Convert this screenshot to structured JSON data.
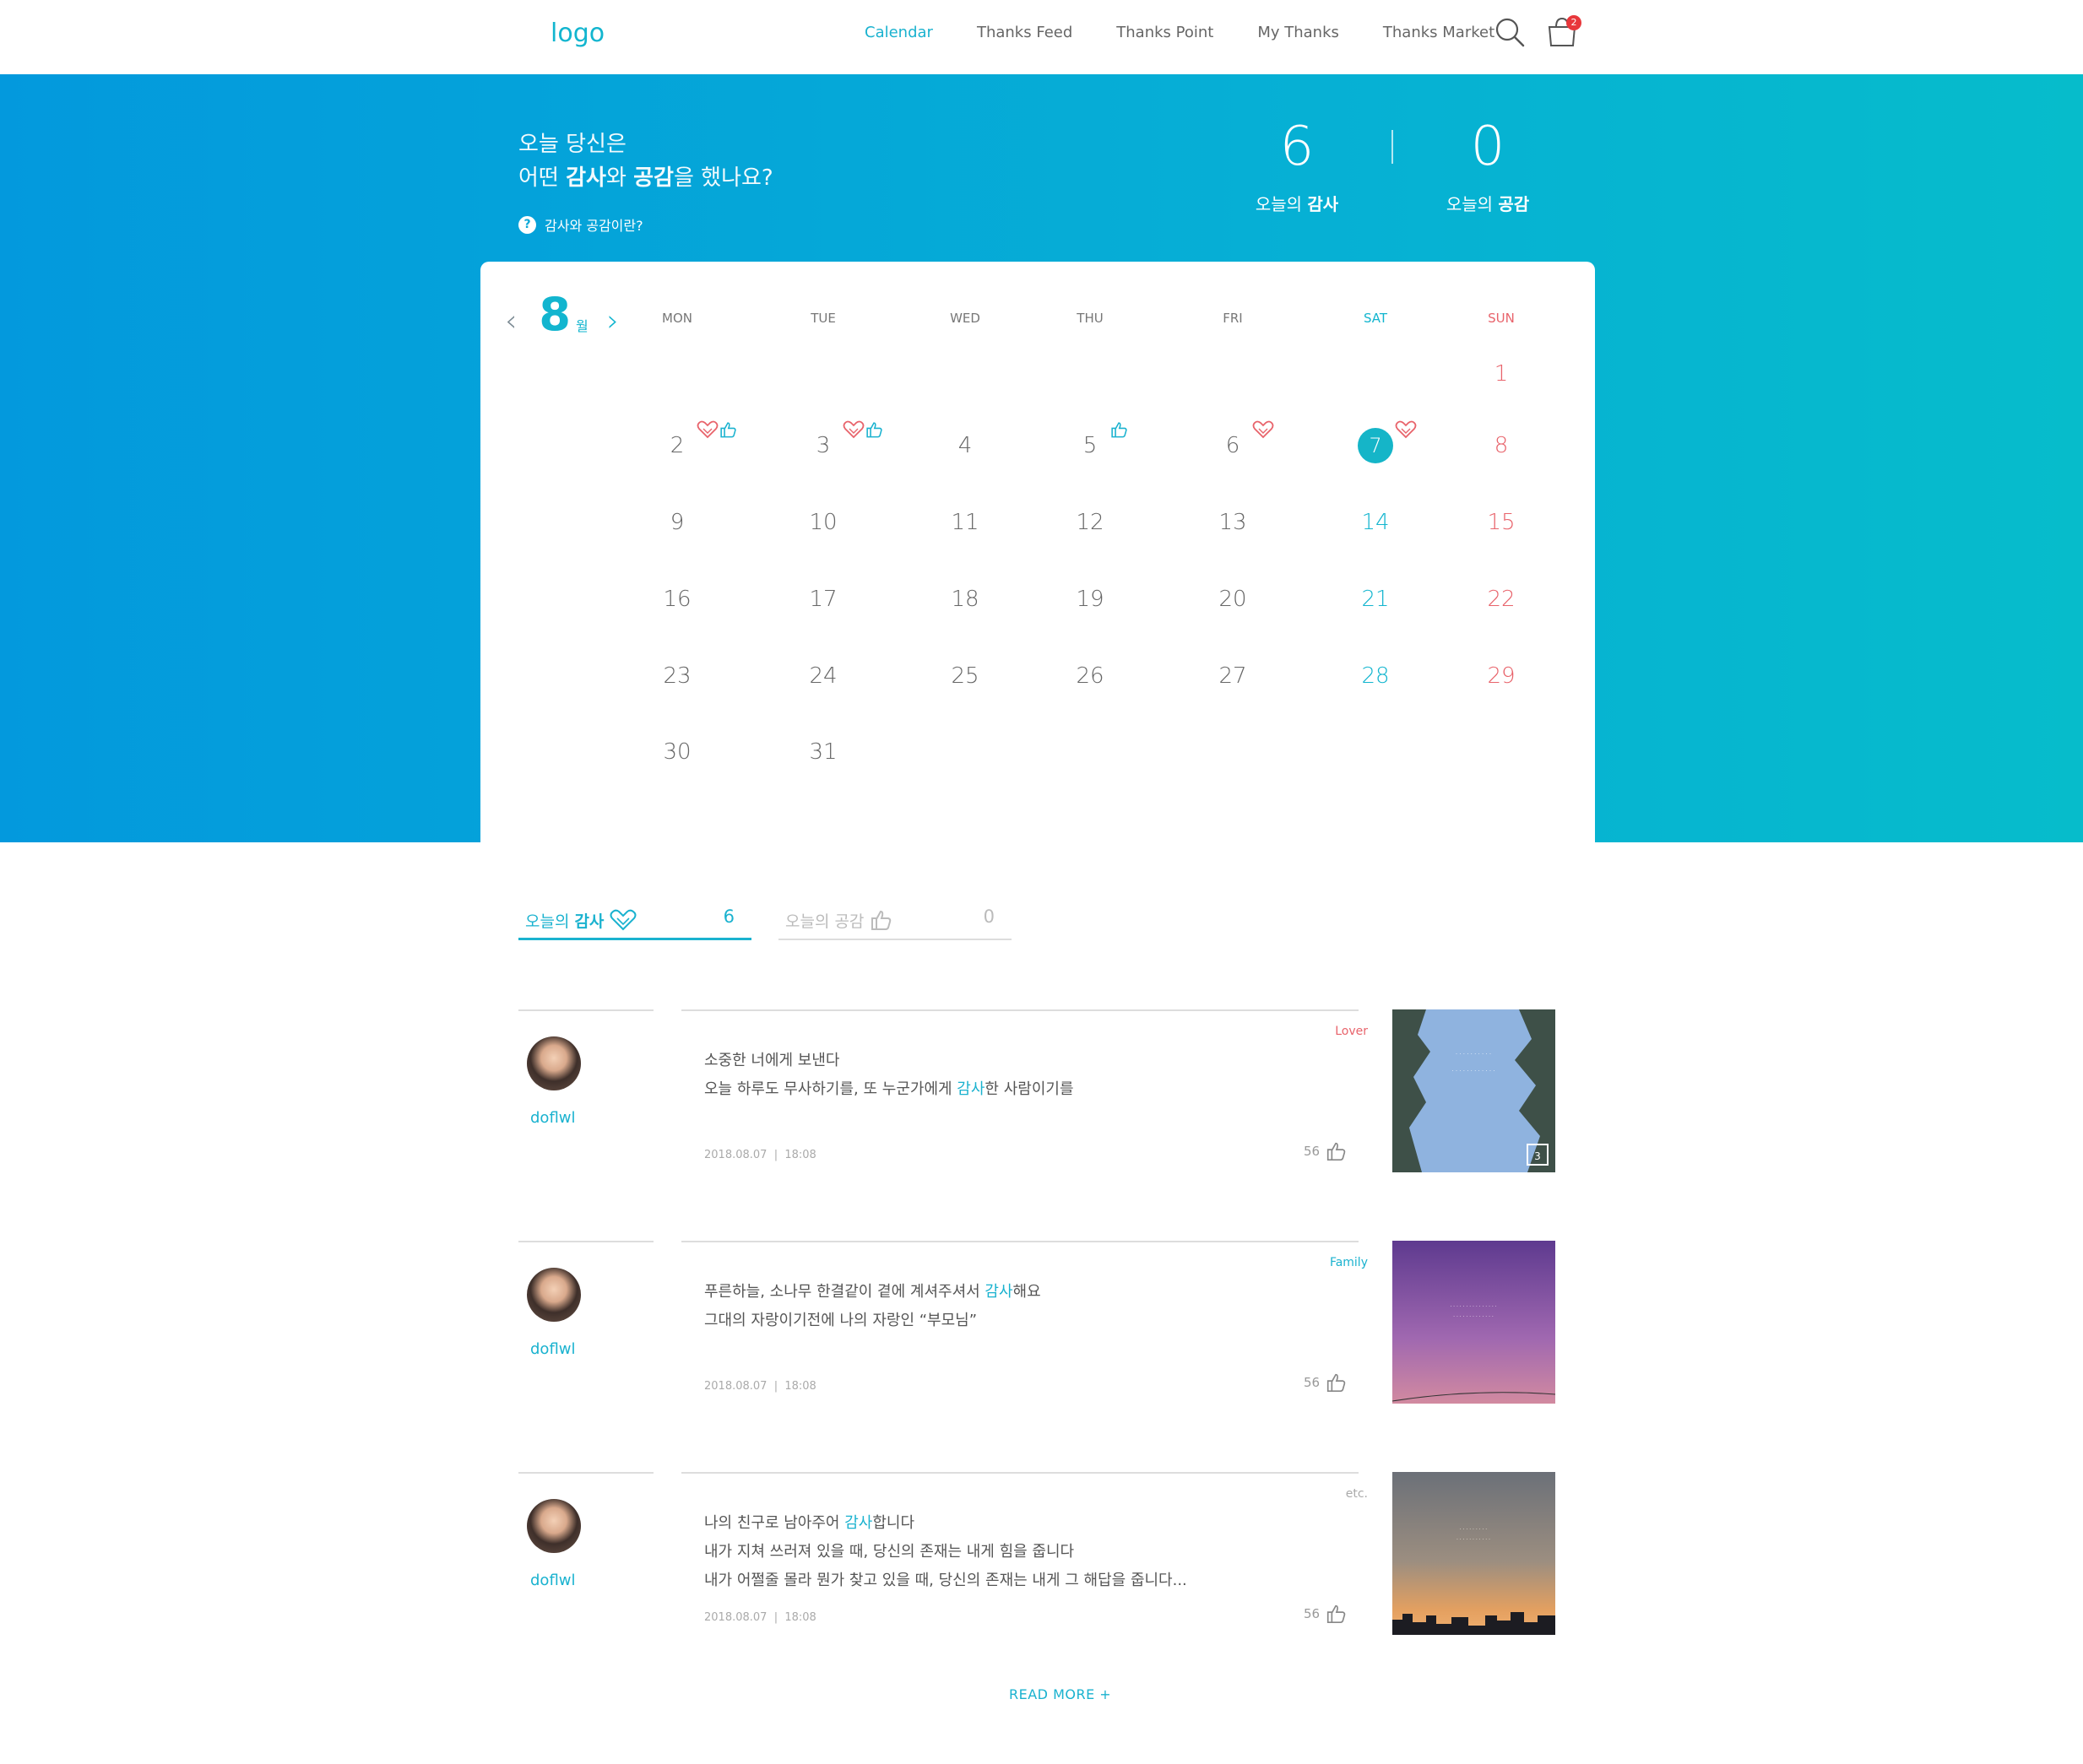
{
  "header": {
    "logo": "logo",
    "nav": [
      "Calendar",
      "Thanks Feed",
      "Thanks Point",
      "My Thanks",
      "Thanks Market"
    ],
    "active_nav": "Calendar",
    "cart_count": "2"
  },
  "hero": {
    "line1": "오늘 당신은",
    "line2_pre": "어떤 ",
    "line2_b1": "감사",
    "line2_mid": "와 ",
    "line2_b2": "공감",
    "line2_post": "을 했나요?",
    "help": "감사와 공감이란?",
    "thanks_count": "6",
    "thanks_label_pre": "오늘의 ",
    "thanks_label_b": "감사",
    "empathy_count": "0",
    "empathy_label_pre": "오늘의 ",
    "empathy_label_b": "공감"
  },
  "calendar": {
    "month": "8",
    "month_unit": "월",
    "weekdays": [
      "MON",
      "TUE",
      "WED",
      "THU",
      "FRI",
      "SAT",
      "SUN"
    ],
    "today": 7,
    "first_weekday_index": 6,
    "days_in_month": 31,
    "marks": {
      "2": [
        "heart",
        "like"
      ],
      "3": [
        "heart",
        "like"
      ],
      "5": [
        "like"
      ],
      "6": [
        "heart"
      ],
      "7": [
        "heart"
      ]
    }
  },
  "tabs": {
    "thanks_pre": "오늘의 ",
    "thanks_b": "감사",
    "thanks_count": "6",
    "empathy_pre": "오늘의 ",
    "empathy_b": "공감",
    "empathy_count": "0"
  },
  "posts": [
    {
      "user": "doflwl",
      "category": "Lover",
      "category_color": "#e8636b",
      "lines": [
        [
          "소중한 너에게 보낸다"
        ],
        [
          "오늘 하루도 무사하기를, 또 누군가에게 ",
          "감사",
          "한 사람이기를"
        ]
      ],
      "date": "2018.08.07",
      "time": "18:08",
      "likes": "56",
      "photo_count": "3"
    },
    {
      "user": "doflwl",
      "category": "Family",
      "category_color": "#1ab2cf",
      "lines": [
        [
          "푸른하늘, 소나무 한결같이 곁에 계셔주셔서 ",
          "감사",
          "해요"
        ],
        [
          "그대의 자랑이기전에 나의 자랑인 “부모님”"
        ]
      ],
      "date": "2018.08.07",
      "time": "18:08",
      "likes": "56"
    },
    {
      "user": "doflwl",
      "category": "etc.",
      "category_color": "#aaaaaa",
      "lines": [
        [
          "나의 친구로 남아주어 ",
          "감사",
          "합니다"
        ],
        [
          "내가 지쳐 쓰러져 있을 때, 당신의 존재는 내게 힘을 줍니다"
        ],
        [
          "내가 어쩔줄 몰라 뭔가 찾고 있을 때, 당신의 존재는 내게 그 해답을 줍니다..."
        ]
      ],
      "date": "2018.08.07",
      "time": "18:08",
      "likes": "56"
    }
  ],
  "read_more": "READ MORE +",
  "colors": {
    "accent": "#1ab2cf",
    "sunday": "#e8636b",
    "badge": "#e8373b"
  }
}
